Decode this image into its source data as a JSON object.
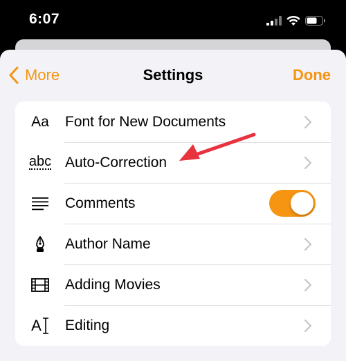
{
  "status_bar": {
    "time": "6:07",
    "icons": [
      "cellular-signal-icon",
      "wifi-icon",
      "battery-icon"
    ]
  },
  "nav": {
    "back_label": "More",
    "title": "Settings",
    "done_label": "Done"
  },
  "settings": {
    "rows": [
      {
        "icon_text": "Aa",
        "label": "Font for New Documents"
      },
      {
        "icon_text": "abc",
        "label": "Auto-Correction"
      },
      {
        "label": "Comments",
        "toggle_on": true
      },
      {
        "label": "Author Name"
      },
      {
        "label": "Adding Movies"
      },
      {
        "icon_text": "A",
        "label": "Editing"
      }
    ]
  },
  "colors": {
    "accent": "#f59512",
    "sheet_background": "#f2f2f7",
    "annotation_arrow": "#e8323e"
  }
}
